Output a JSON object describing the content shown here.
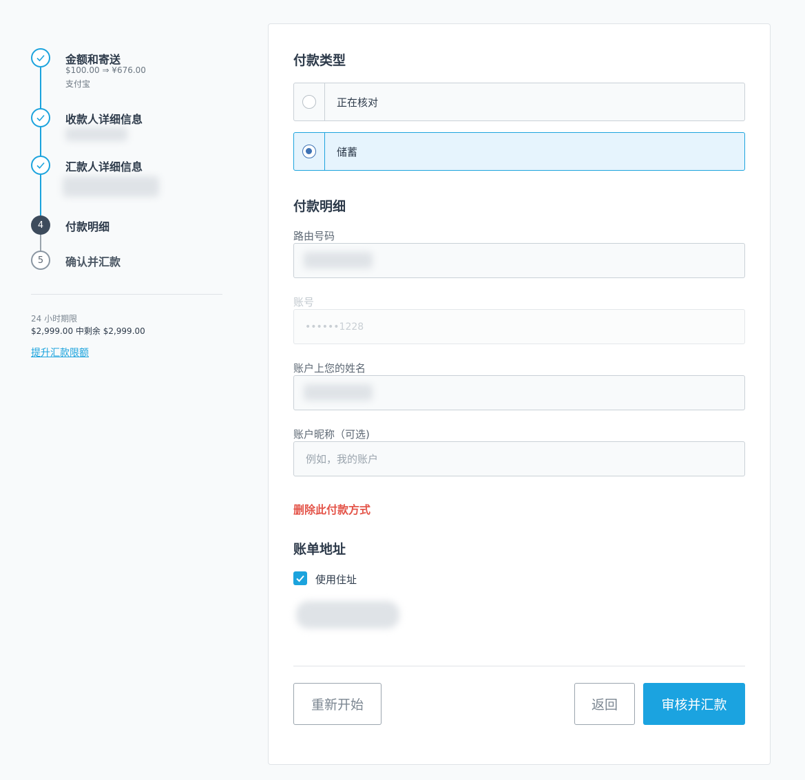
{
  "stepper": {
    "steps": [
      {
        "number": "1",
        "title": "金额和寄送",
        "amount": "$100.00 ⇒ ¥676.00",
        "method": "支付宝",
        "status": "done"
      },
      {
        "number": "2",
        "title": "收款人详细信息",
        "status": "done"
      },
      {
        "number": "3",
        "title": "汇款人详细信息",
        "status": "done"
      },
      {
        "number": "4",
        "title": "付款明细",
        "status": "current"
      },
      {
        "number": "5",
        "title": "确认并汇款",
        "status": "future"
      }
    ],
    "accent_color": "#1ba3dd"
  },
  "limit": {
    "label": "24 小时期限",
    "value": "$2,999.00 中剩余 $2,999.00",
    "link": "提升汇款限额"
  },
  "payment_type": {
    "title": "付款类型",
    "options": [
      {
        "label": "正在核对",
        "selected": false
      },
      {
        "label": "储蓄",
        "selected": true
      }
    ]
  },
  "payment_details": {
    "title": "付款明细",
    "routing_label": "路由号码",
    "account_label": "账号",
    "account_value": "••••••1228",
    "name_label": "账户上您的姓名",
    "nickname_label": "账户昵称（可选)",
    "nickname_placeholder": "例如，我的账户"
  },
  "delete_link": "删除此付款方式",
  "billing": {
    "title": "账单地址",
    "use_address_label": "使用住址",
    "use_address_checked": true
  },
  "actions": {
    "restart": "重新开始",
    "back": "返回",
    "submit": "审核并汇款",
    "submit_color": "#1ba3e0"
  }
}
